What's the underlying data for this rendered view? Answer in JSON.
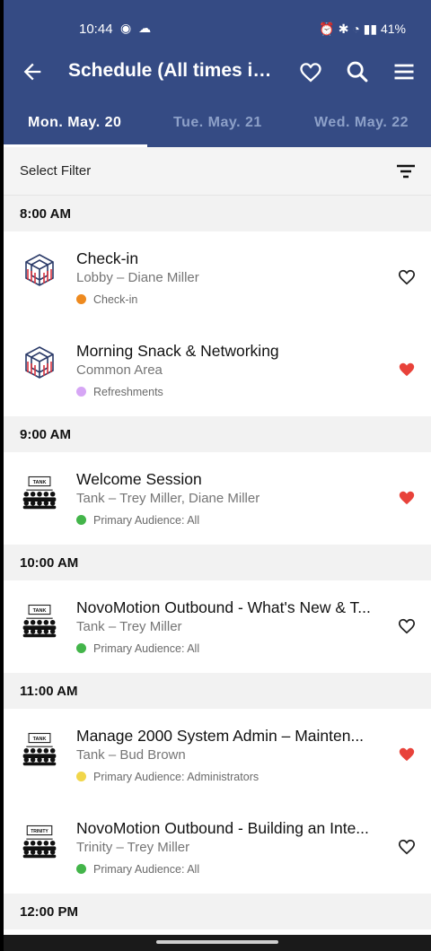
{
  "status_bar": {
    "time": "10:44",
    "left_icons": "◉ ☁",
    "right_text": "⏰ ✱ ◔ ▮▮ 41%"
  },
  "app_bar": {
    "title": "Schedule (All times in ...",
    "icons": [
      "back-arrow-icon",
      "heart-icon",
      "search-icon",
      "menu-icon"
    ]
  },
  "tabs": [
    {
      "label": "Mon. May. 20",
      "active": true
    },
    {
      "label": "Tue. May. 21",
      "active": false
    },
    {
      "label": "Wed. May. 22",
      "active": false
    }
  ],
  "filter": {
    "label": "Select Filter"
  },
  "time_groups": [
    {
      "time": "8:00 AM"
    },
    {
      "time": "9:00 AM"
    },
    {
      "time": "10:00 AM"
    },
    {
      "time": "11:00 AM"
    },
    {
      "time": "12:00 PM"
    }
  ],
  "sessions": [
    {
      "title": "Check-in",
      "subtitle": "Lobby – Diane Miller",
      "tag": "Check-in",
      "tag_color": "#ee8a1f",
      "favorited": false,
      "logo": "conference-logo-icon"
    },
    {
      "title": "Morning Snack & Networking",
      "subtitle": "Common Area",
      "tag": "Refreshments",
      "tag_color": "#d6a6f5",
      "favorited": true,
      "logo": "conference-logo-icon"
    },
    {
      "title": "Welcome Session",
      "subtitle": "Tank – Trey Miller, Diane Miller",
      "tag": "Primary Audience: All",
      "tag_color": "#43b54a",
      "favorited": true,
      "logo": "room-audience-icon",
      "room_label": "TANK"
    },
    {
      "title": "NovoMotion Outbound - What's New & T...",
      "subtitle": "Tank – Trey Miller",
      "tag": "Primary Audience: All",
      "tag_color": "#43b54a",
      "favorited": false,
      "logo": "room-audience-icon",
      "room_label": "TANK"
    },
    {
      "title": "Manage 2000 System Admin – Mainten...",
      "subtitle": "Tank – Bud Brown",
      "tag": "Primary Audience: Administrators",
      "tag_color": "#f1d64a",
      "favorited": true,
      "logo": "room-audience-icon",
      "room_label": "TANK"
    },
    {
      "title": "NovoMotion Outbound - Building an Inte...",
      "subtitle": "Trinity – Trey Miller",
      "tag": "Primary Audience: All",
      "tag_color": "#43b54a",
      "favorited": false,
      "logo": "room-audience-icon",
      "room_label": "TRINITY"
    }
  ],
  "colors": {
    "header_bg": "#354b84",
    "favorite_active": "#e8423a",
    "favorite_inactive": "#222222"
  }
}
